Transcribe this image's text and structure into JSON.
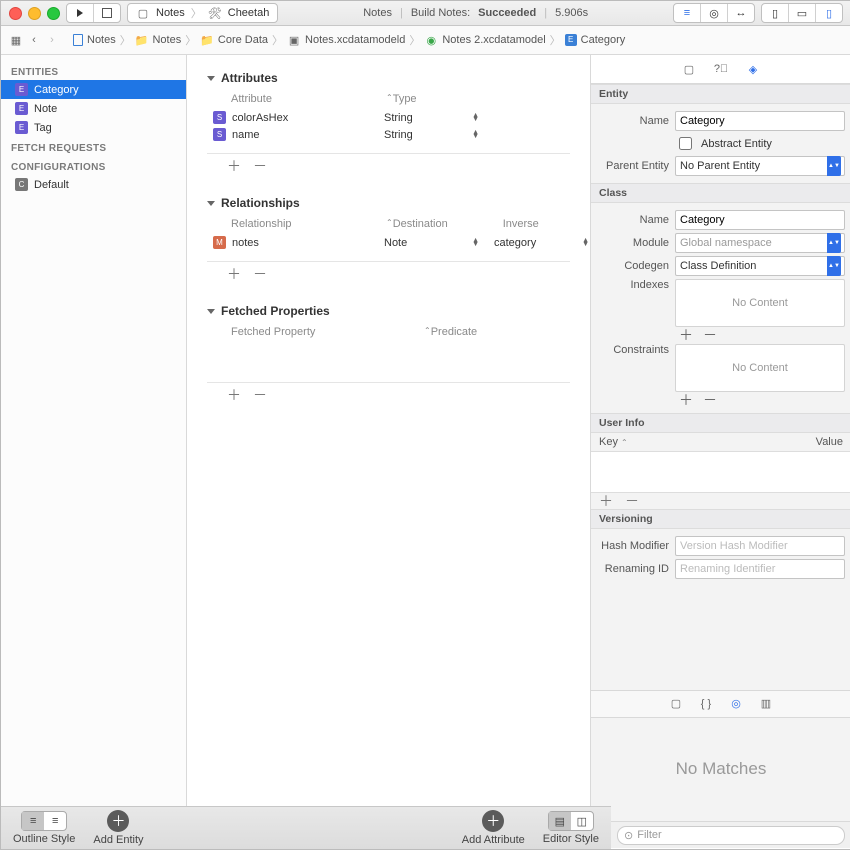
{
  "titlebar": {
    "scheme_name": "Notes",
    "scheme_target": "Cheetah",
    "project": "Notes",
    "build_status_prefix": "Build Notes:",
    "build_status": "Succeeded",
    "build_time": "5.906s"
  },
  "breadcrumb": {
    "items": [
      "Notes",
      "Notes",
      "Core Data",
      "Notes.xcdatamodeld",
      "Notes 2.xcdatamodel",
      "Category"
    ]
  },
  "nav": {
    "sections": {
      "entities_label": "ENTITIES",
      "fetch_label": "FETCH REQUESTS",
      "config_label": "CONFIGURATIONS"
    },
    "entities": [
      {
        "icon": "E",
        "name": "Category",
        "selected": true
      },
      {
        "icon": "E",
        "name": "Note",
        "selected": false
      },
      {
        "icon": "E",
        "name": "Tag",
        "selected": false
      }
    ],
    "configs": [
      {
        "icon": "C",
        "name": "Default"
      }
    ]
  },
  "editor": {
    "sections": {
      "attributes": {
        "label": "Attributes",
        "cols": [
          "Attribute",
          "Type"
        ],
        "rows": [
          {
            "icon": "S",
            "name": "colorAsHex",
            "type": "String"
          },
          {
            "icon": "S",
            "name": "name",
            "type": "String"
          }
        ]
      },
      "relationships": {
        "label": "Relationships",
        "cols": [
          "Relationship",
          "Destination",
          "Inverse"
        ],
        "rows": [
          {
            "icon": "M",
            "name": "notes",
            "destination": "Note",
            "inverse": "category"
          }
        ]
      },
      "fetched": {
        "label": "Fetched Properties",
        "cols": [
          "Fetched Property",
          "Predicate"
        ],
        "rows": []
      }
    }
  },
  "inspector": {
    "entity": {
      "section": "Entity",
      "name_label": "Name",
      "name_value": "Category",
      "abstract_label": "Abstract Entity",
      "abstract_checked": false,
      "parent_label": "Parent Entity",
      "parent_value": "No Parent Entity"
    },
    "cls": {
      "section": "Class",
      "name_label": "Name",
      "name_value": "Category",
      "module_label": "Module",
      "module_placeholder": "Global namespace",
      "codegen_label": "Codegen",
      "codegen_value": "Class Definition",
      "indexes_label": "Indexes",
      "constraints_label": "Constraints",
      "no_content": "No Content"
    },
    "userinfo": {
      "section": "User Info",
      "key": "Key",
      "value": "Value"
    },
    "versioning": {
      "section": "Versioning",
      "hash_label": "Hash Modifier",
      "hash_placeholder": "Version Hash Modifier",
      "rename_label": "Renaming ID",
      "rename_placeholder": "Renaming Identifier"
    },
    "no_matches": "No Matches",
    "filter_placeholder": "Filter"
  },
  "bottombar": {
    "outline_label": "Outline Style",
    "add_entity_label": "Add Entity",
    "add_attr_label": "Add Attribute",
    "editor_style_label": "Editor Style"
  }
}
